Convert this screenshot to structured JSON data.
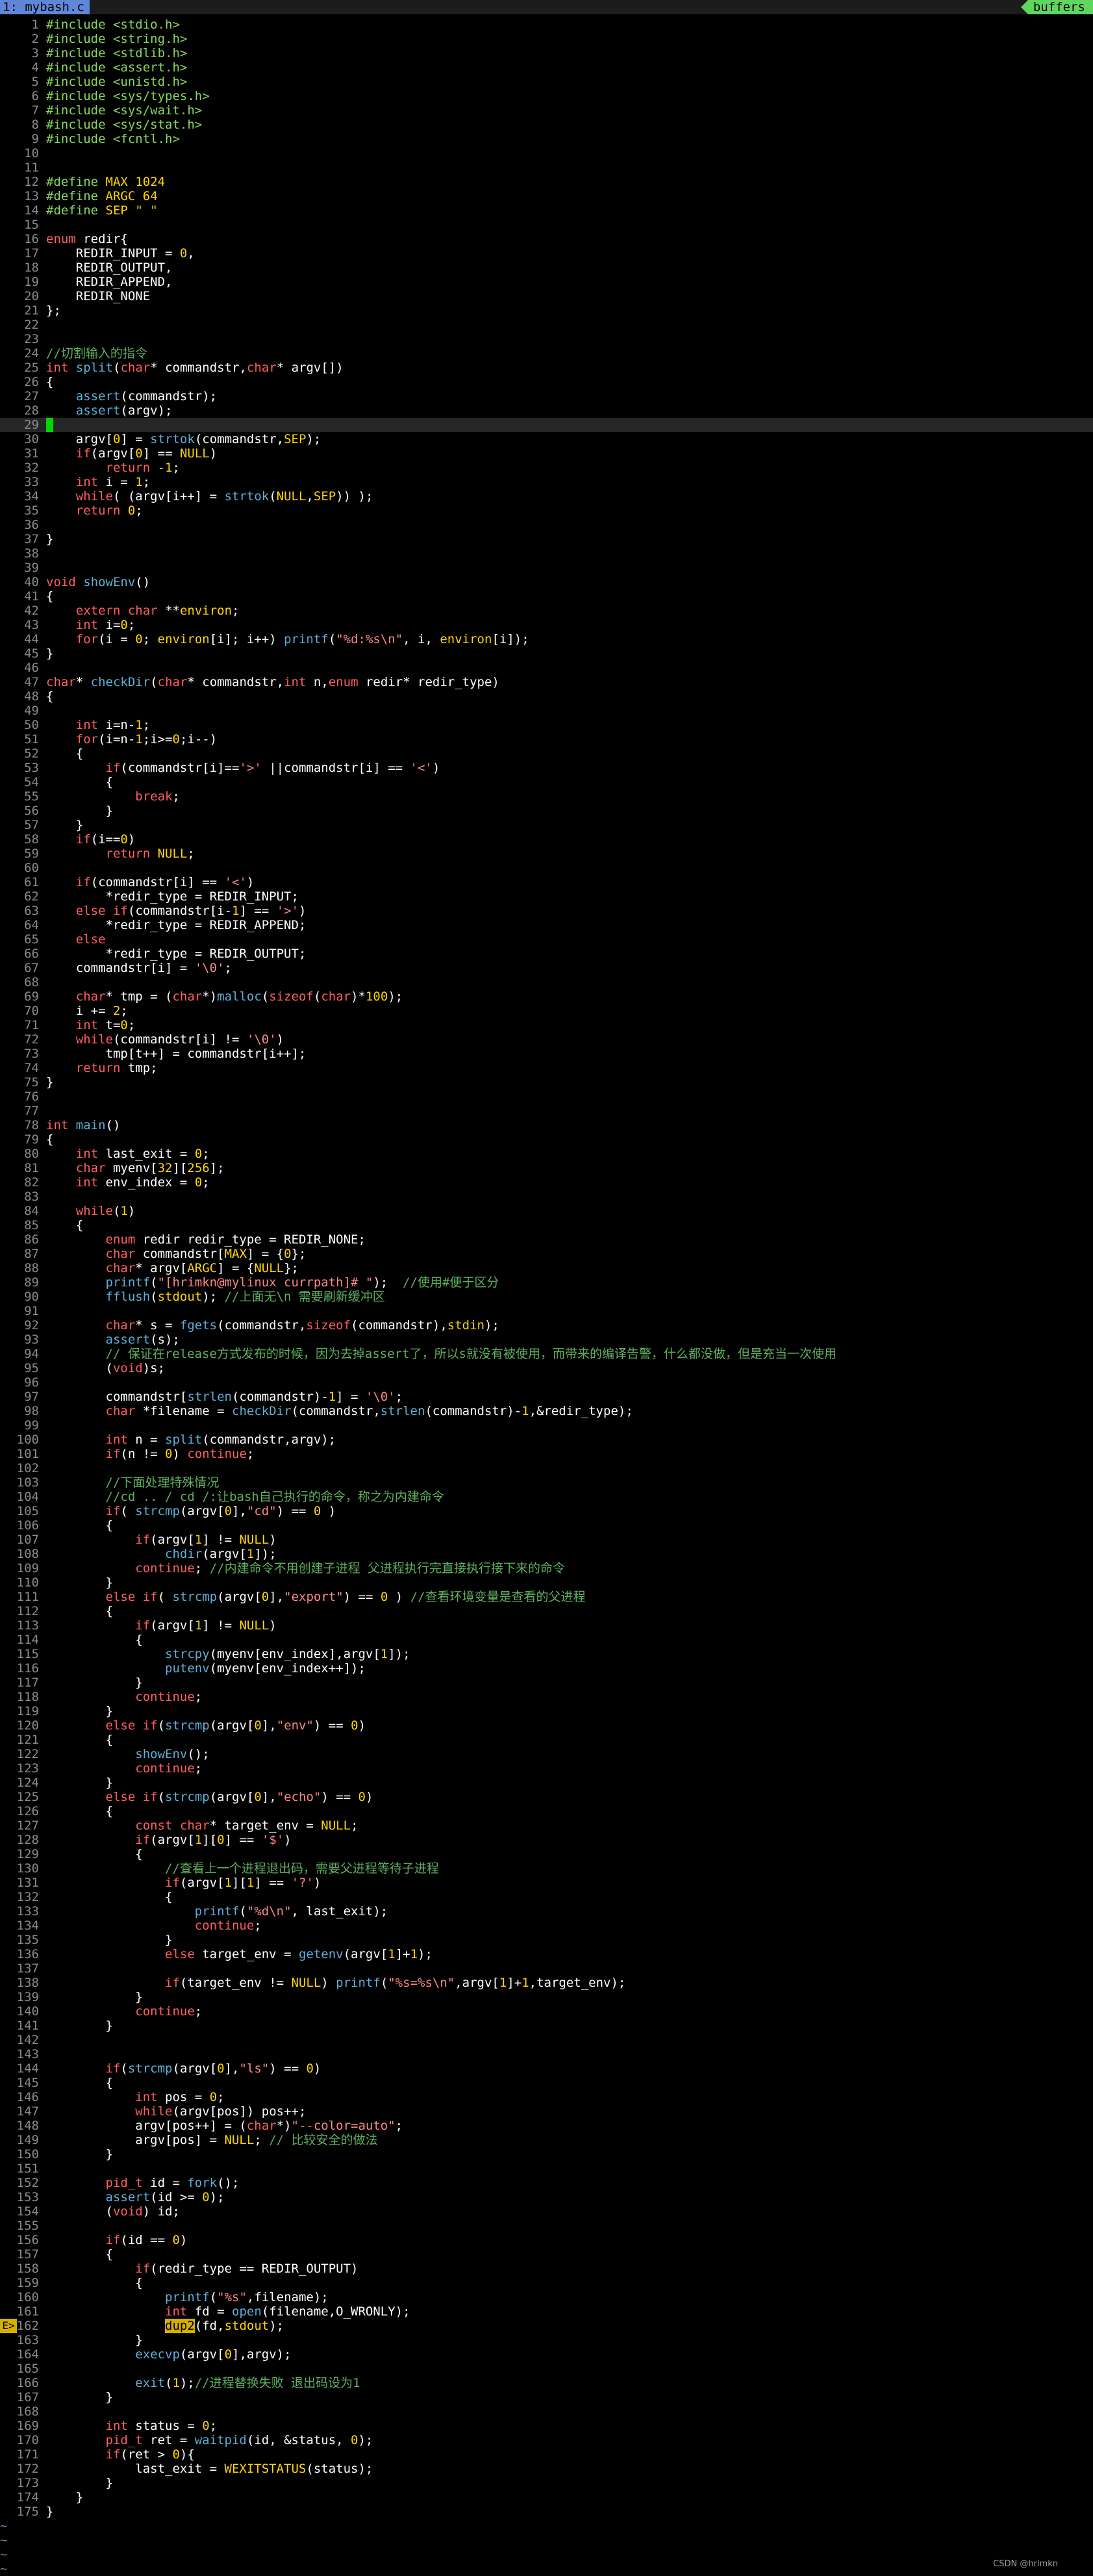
{
  "tabline": {
    "active_tab": "1: mybash.c",
    "right_label": "buffers"
  },
  "editor": {
    "cursor_line": 29,
    "error_sign": {
      "line": 162,
      "label": "E>"
    },
    "lines": [
      "#include <stdio.h>",
      "#include <string.h>",
      "#include <stdlib.h>",
      "#include <assert.h>",
      "#include <unistd.h>",
      "#include <sys/types.h>",
      "#include <sys/wait.h>",
      "#include <sys/stat.h>",
      "#include <fcntl.h>",
      "",
      "",
      "#define MAX 1024",
      "#define ARGC 64",
      "#define SEP \" \"",
      "",
      "enum redir{",
      "    REDIR_INPUT = 0,",
      "    REDIR_OUTPUT,",
      "    REDIR_APPEND,",
      "    REDIR_NONE",
      "};",
      "",
      "",
      "//切割输入的指令",
      "int split(char* commandstr,char* argv[])",
      "{",
      "    assert(commandstr);",
      "    assert(argv);",
      "",
      "    argv[0] = strtok(commandstr,SEP);",
      "    if(argv[0] == NULL)",
      "        return -1;",
      "    int i = 1;",
      "    while( (argv[i++] = strtok(NULL,SEP)) );",
      "    return 0;",
      "",
      "}",
      "",
      "",
      "void showEnv()",
      "{",
      "    extern char **environ;",
      "    int i=0;",
      "    for(i = 0; environ[i]; i++) printf(\"%d:%s\\n\", i, environ[i]);",
      "}",
      "",
      "char* checkDir(char* commandstr,int n,enum redir* redir_type)",
      "{",
      "",
      "    int i=n-1;",
      "    for(i=n-1;i>=0;i--)",
      "    {",
      "        if(commandstr[i]=='>' ||commandstr[i] == '<')",
      "        {",
      "            break;",
      "        }",
      "    }",
      "    if(i==0)",
      "        return NULL;",
      "",
      "    if(commandstr[i] == '<')",
      "        *redir_type = REDIR_INPUT;",
      "    else if(commandstr[i-1] == '>')",
      "        *redir_type = REDIR_APPEND;",
      "    else",
      "        *redir_type = REDIR_OUTPUT;",
      "    commandstr[i] = '\\0';",
      "",
      "    char* tmp = (char*)malloc(sizeof(char)*100);",
      "    i += 2;",
      "    int t=0;",
      "    while(commandstr[i] != '\\0')",
      "        tmp[t++] = commandstr[i++];",
      "    return tmp;",
      "}",
      "",
      "",
      "int main()",
      "{",
      "    int last_exit = 0;",
      "    char myenv[32][256];",
      "    int env_index = 0;",
      "",
      "    while(1)",
      "    {",
      "        enum redir redir_type = REDIR_NONE;",
      "        char commandstr[MAX] = {0};",
      "        char* argv[ARGC] = {NULL};",
      "        printf(\"[hrimkn@mylinux currpath]# \");  //使用#便于区分",
      "        fflush(stdout); //上面无\\n 需要刷新缓冲区",
      "",
      "        char* s = fgets(commandstr,sizeof(commandstr),stdin);",
      "        assert(s);",
      "        // 保证在release方式发布的时候，因为去掉assert了，所以s就没有被使用，而带来的编译告警，什么都没做，但是充当一次使用",
      "        (void)s;",
      "",
      "        commandstr[strlen(commandstr)-1] = '\\0';",
      "        char *filename = checkDir(commandstr,strlen(commandstr)-1,&redir_type);",
      "",
      "        int n = split(commandstr,argv);",
      "        if(n != 0) continue;",
      "",
      "        //下面处理特殊情况",
      "        //cd .. / cd /:让bash自己执行的命令，称之为内建命令",
      "        if( strcmp(argv[0],\"cd\") == 0 )",
      "        {",
      "            if(argv[1] != NULL)",
      "                chdir(argv[1]);",
      "            continue; //内建命令不用创建子进程 父进程执行完直接执行接下来的命令",
      "        }",
      "        else if( strcmp(argv[0],\"export\") == 0 ) //查看环境变量是查看的父进程",
      "        {",
      "            if(argv[1] != NULL)",
      "            {",
      "                strcpy(myenv[env_index],argv[1]);",
      "                putenv(myenv[env_index++]);",
      "            }",
      "            continue;",
      "        }",
      "        else if(strcmp(argv[0],\"env\") == 0)",
      "        {",
      "            showEnv();",
      "            continue;",
      "        }",
      "        else if(strcmp(argv[0],\"echo\") == 0)",
      "        {",
      "            const char* target_env = NULL;",
      "            if(argv[1][0] == '$')",
      "            {",
      "                //查看上一个进程退出码，需要父进程等待子进程",
      "                if(argv[1][1] == '?')",
      "                {",
      "                    printf(\"%d\\n\", last_exit);",
      "                    continue;",
      "                }",
      "                else target_env = getenv(argv[1]+1);",
      "",
      "                if(target_env != NULL) printf(\"%s=%s\\n\",argv[1]+1,target_env);",
      "            }",
      "            continue;",
      "        }",
      "",
      "",
      "        if(strcmp(argv[0],\"ls\") == 0)",
      "        {",
      "            int pos = 0;",
      "            while(argv[pos]) pos++;",
      "            argv[pos++] = (char*)\"--color=auto\";",
      "            argv[pos] = NULL; // 比较安全的做法",
      "        }",
      "",
      "        pid_t id = fork();",
      "        assert(id >= 0);",
      "        (void) id;",
      "",
      "        if(id == 0)",
      "        {",
      "            if(redir_type == REDIR_OUTPUT)",
      "            {",
      "                printf(\"%s\",filename);",
      "                int fd = open(filename,O_WRONLY);",
      "                dup2(fd,stdout);",
      "            }",
      "            execvp(argv[0],argv);",
      "",
      "            exit(1);//进程替换失败 退出码设为1",
      "        }",
      "",
      "        int status = 0;",
      "        pid_t ret = waitpid(id, &status, 0);",
      "        if(ret > 0){",
      "            last_exit = WEXITSTATUS(status);",
      "        }",
      "    }",
      "}"
    ],
    "tilde_rows": 4,
    "tilde_char": "~"
  },
  "watermark": "CSDN @hrimkn"
}
